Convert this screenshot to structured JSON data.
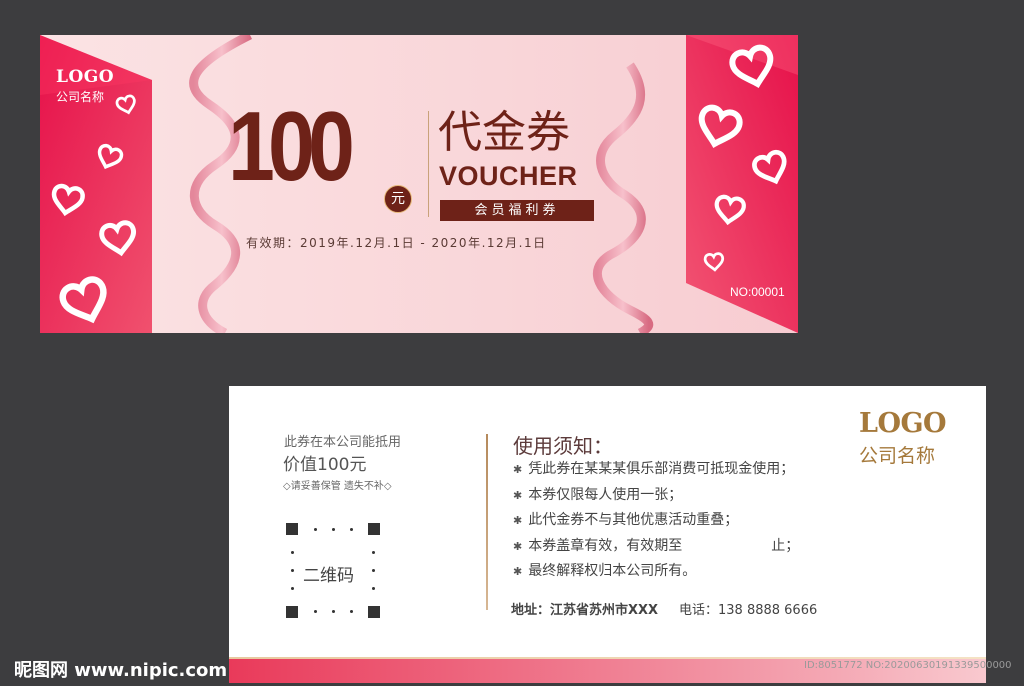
{
  "front": {
    "logo": "LOGO",
    "company": "公司名称",
    "amount": "100",
    "currency": "元",
    "title_cn": "代金券",
    "title_en": "VOUCHER",
    "member_label": "会员福利券",
    "validity": "有效期：2019年.12月.1日 - 2020年.12月.1日",
    "number": "NO:00001",
    "colors": {
      "accent": "#e8194b",
      "brown": "#6e2218",
      "pink_bg": "#fbe3e4"
    }
  },
  "back": {
    "use_line1": "此券在本公司能抵用",
    "use_line2": "价值100元",
    "keep_note": "◇请妥善保管 遗失不补◇",
    "qr_label": "二维码",
    "notice_title": "使用须知：",
    "notices": [
      "凭此券在某某某俱乐部消费可抵现金使用；",
      "本券仅限每人使用一张；",
      "此代金券不与其他优惠活动重叠；",
      "本券盖章有效，有效期至                    止；",
      "最终解释权归本公司所有。"
    ],
    "address": "地址：江苏省苏州市XXX",
    "phone": "电话：138 8888 6666",
    "logo": "LOGO",
    "company": "公司名称"
  },
  "watermark": {
    "site": "昵图网 www.nipic.com",
    "id": "ID:8051772 NO:20200630191339500000"
  }
}
